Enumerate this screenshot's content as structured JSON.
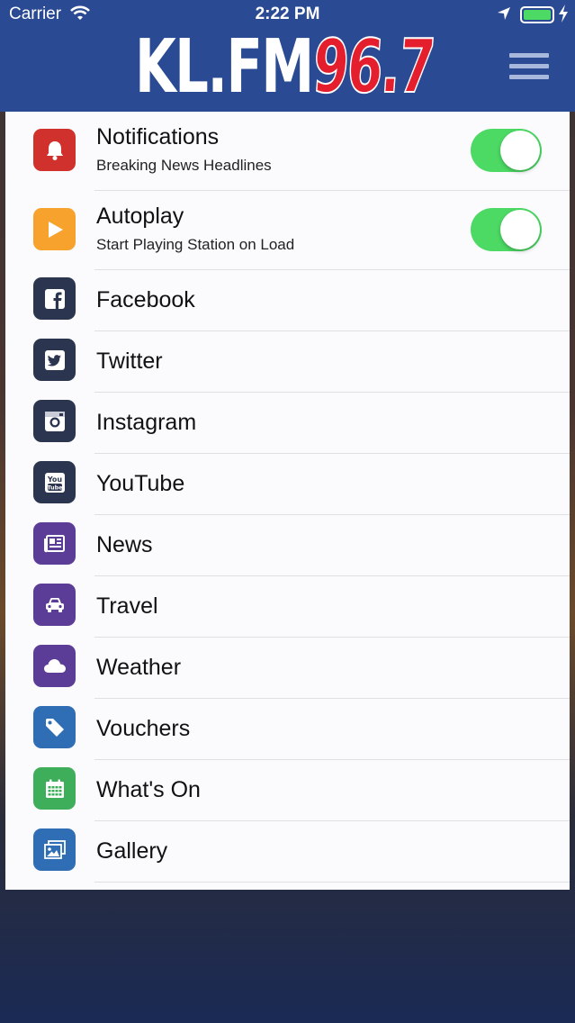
{
  "status_bar": {
    "carrier": "Carrier",
    "time": "2:22 PM"
  },
  "header": {
    "logo_text": "KL.FM",
    "logo_number": "96.7",
    "menu_icon": "hamburger-menu-icon"
  },
  "settings": {
    "notifications": {
      "label": "Notifications",
      "subtitle": "Breaking News Headlines",
      "enabled": true,
      "icon": "bell-icon",
      "color": "#d0312d"
    },
    "autoplay": {
      "label": "Autoplay",
      "subtitle": "Start Playing Station on Load",
      "enabled": true,
      "icon": "play-icon",
      "color": "#f7a22c"
    }
  },
  "menu": {
    "items": [
      {
        "label": "Facebook",
        "icon": "facebook-icon",
        "color": "#2c3550"
      },
      {
        "label": "Twitter",
        "icon": "twitter-icon",
        "color": "#2c3550"
      },
      {
        "label": "Instagram",
        "icon": "instagram-icon",
        "color": "#2c3550"
      },
      {
        "label": "YouTube",
        "icon": "youtube-icon",
        "color": "#2c3550"
      },
      {
        "label": "News",
        "icon": "newspaper-icon",
        "color": "#5b3c96"
      },
      {
        "label": "Travel",
        "icon": "car-icon",
        "color": "#5b3c96"
      },
      {
        "label": "Weather",
        "icon": "cloud-icon",
        "color": "#5b3c96"
      },
      {
        "label": "Vouchers",
        "icon": "tag-icon",
        "color": "#2f6db5"
      },
      {
        "label": "What's On",
        "icon": "calendar-icon",
        "color": "#3fae5a"
      },
      {
        "label": "Gallery",
        "icon": "gallery-icon",
        "color": "#2f6db5"
      }
    ]
  },
  "colors": {
    "header_bg": "#2a4a93",
    "toggle_on": "#4cd964",
    "logo_red": "#e41e2d"
  }
}
